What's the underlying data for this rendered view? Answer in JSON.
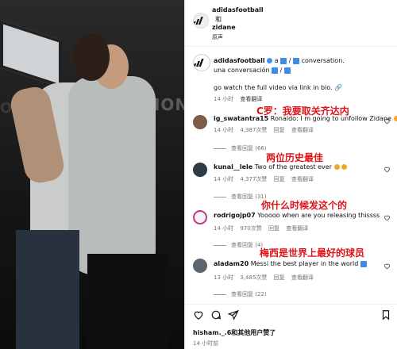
{
  "header": {
    "account": "adidasfootball",
    "and": "和",
    "collab": "zidane",
    "audio": "原声"
  },
  "caption": {
    "account": "adidasfootball",
    "text1": "a",
    "text2": "conversation.",
    "text3": "una conversación",
    "text4": "go watch the full video via link in bio.",
    "time": "14 小时",
    "translate": "查看翻译"
  },
  "annotations": {
    "a1": "C罗：我要取关齐达内",
    "a2": "两位历史最佳",
    "a3": "你什么时候发这个的",
    "a4": "梅西是世界上最好的球员"
  },
  "comments": [
    {
      "user": "ig_swatantra15",
      "text": "Ronaldo: I m going to unfollow Zidane",
      "time": "14 小时",
      "likes": "4,387次赞",
      "reply": "回复",
      "translate": "查看翻译",
      "replies": "查看回复 (66)"
    },
    {
      "user": "kunal__lele",
      "text": "Two of the greatest ever",
      "time": "14 小时",
      "likes": "4,377次赞",
      "reply": "回复",
      "translate": "查看翻译",
      "replies": "查看回复 (31)"
    },
    {
      "user": "rodrigojp07",
      "text": "Yooooo when are you releasing thissss",
      "time": "14 小时",
      "likes": "970次赞",
      "reply": "回复",
      "translate": "查看翻译",
      "replies": "查看回复 (4)"
    },
    {
      "user": "aladam20",
      "text": "Messi the best player in the world",
      "time": "13 小时",
      "likes": "3,485次赞",
      "reply": "回复",
      "translate": "查看翻译",
      "replies": "查看回复 (22)"
    }
  ],
  "footer": {
    "liked_by": "hisham._.6和其他用户赞了",
    "time": "14 小时前"
  },
  "icons": {
    "heart": "heart-icon",
    "comment": "comment-icon",
    "share": "share-icon",
    "save": "bookmark-icon",
    "more": "more-icon"
  },
  "colors": {
    "annotation": "#e0131a",
    "verified": "#3897f0"
  }
}
